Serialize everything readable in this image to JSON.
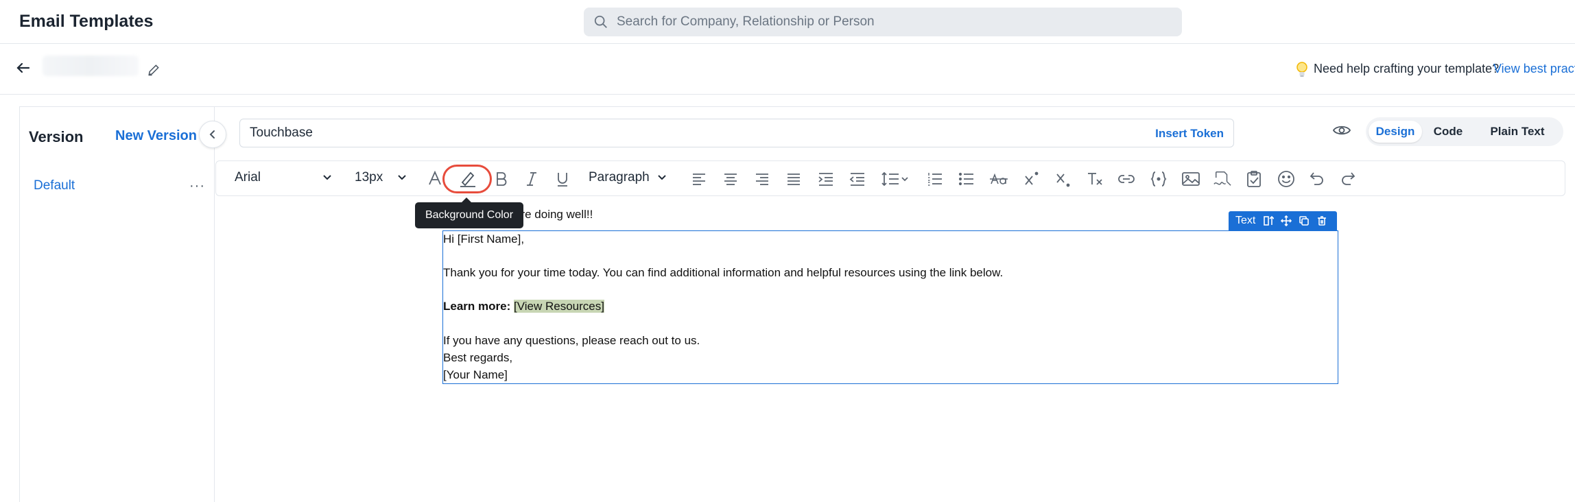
{
  "header": {
    "title": "Email Templates",
    "search_placeholder": "Search for Company, Relationship or Person"
  },
  "subheader": {
    "help_text": "Need help crafting your template?",
    "help_link": "View best practi"
  },
  "version_panel": {
    "title": "Version",
    "new_version": "New Version",
    "items": [
      {
        "label": "Default",
        "more": "···"
      }
    ]
  },
  "subject": {
    "value": "Touchbase",
    "insert_token": "Insert Token"
  },
  "modes": {
    "design": "Design",
    "code": "Code",
    "plain": "Plain Text",
    "active": "Design"
  },
  "toolbar": {
    "font_family": "Arial",
    "font_size": "13px",
    "block_format": "Paragraph",
    "tooltip": "Background Color",
    "highlight_color": "#e74c3c"
  },
  "email": {
    "greeting_partial": "are doing well!!",
    "block_tag": "Text",
    "lines": {
      "hi": "Hi [First Name],",
      "thanks": "Thank you for your time today. You can find additional information and helpful resources using the link below.",
      "learn_label": "Learn more:",
      "learn_link": "[View Resources]",
      "questions": "If you have any questions, please reach out to us.",
      "regards": "Best regards,",
      "name": "[Your Name]"
    }
  },
  "colors": {
    "accent": "#1a6fd6",
    "link_highlight": "#c8d6b4"
  }
}
